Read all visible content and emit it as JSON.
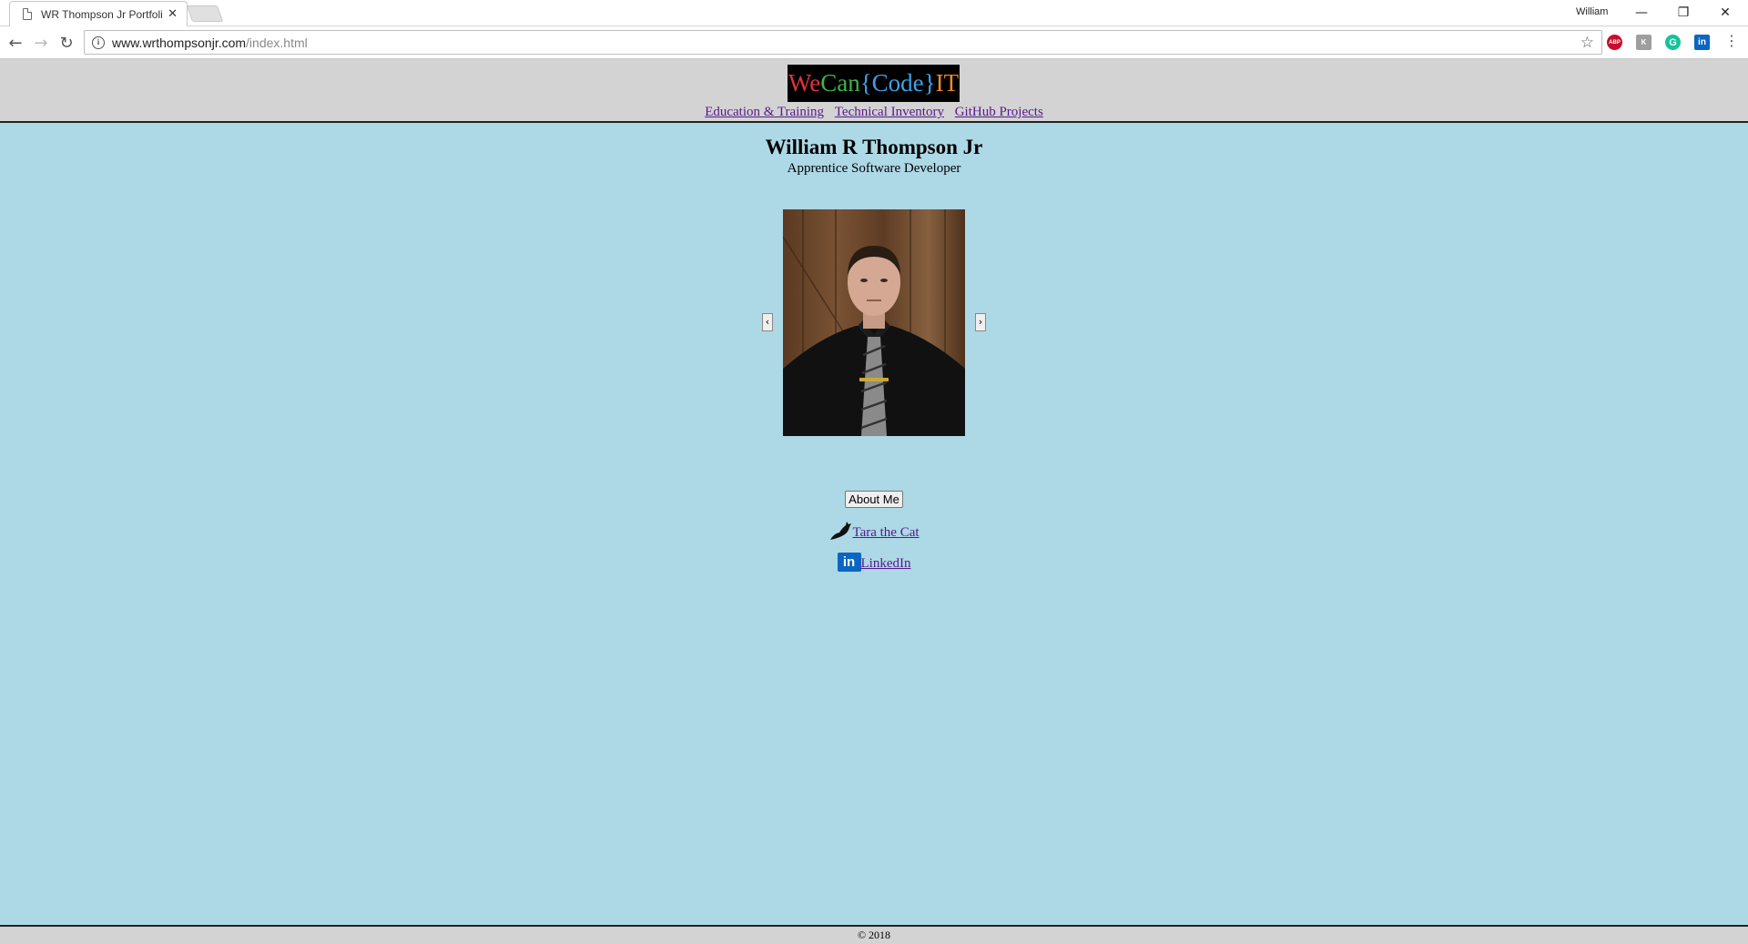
{
  "browser": {
    "tab_title": "WR Thompson Jr Portfoli",
    "tab_close": "✕",
    "profile_name": "William",
    "url_host": "www.wrthompsonjr.com",
    "url_path": "/index.html",
    "window_controls": {
      "minimize": "—",
      "restore": "❐",
      "close": "✕"
    },
    "nav": {
      "back": "←",
      "forward": "→",
      "reload": "↻"
    },
    "star": "☆",
    "menu": "⋮",
    "extensions": [
      {
        "name": "adblock-plus-icon",
        "label": "ABP"
      },
      {
        "name": "extension-gray-icon",
        "label": "K"
      },
      {
        "name": "grammarly-icon",
        "label": "G"
      },
      {
        "name": "linkedin-ext-icon",
        "label": "in"
      }
    ]
  },
  "header": {
    "logo": {
      "we": "We",
      "can": "Can",
      "code": "{Code}",
      "it": "IT"
    },
    "nav_links": [
      "Education & Training",
      "Technical Inventory",
      "GitHub Projects"
    ]
  },
  "main": {
    "name": "William R Thompson Jr",
    "role": "Apprentice Software Developer",
    "slider_prev": "‹",
    "slider_next": "›",
    "about_button": "About Me",
    "cat_link": "Tara the Cat",
    "linkedin_badge": "in",
    "linkedin_link": "LinkedIn"
  },
  "footer": {
    "copyright": "© 2018"
  },
  "colors": {
    "page_bg": "#add8e6",
    "header_bg": "#d3d3d3",
    "link": "#551a8b"
  }
}
